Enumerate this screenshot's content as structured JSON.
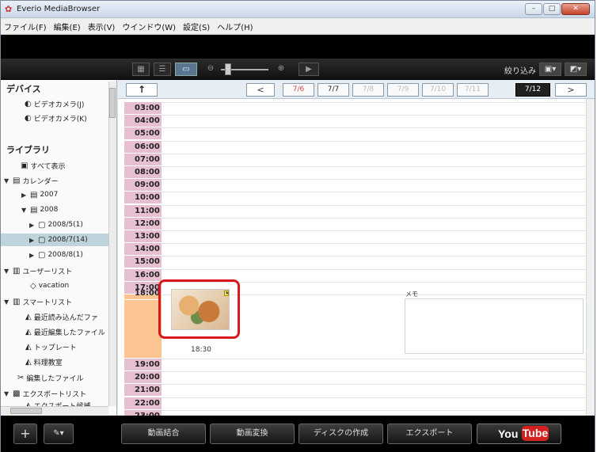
{
  "window": {
    "title": "Everio MediaBrowser",
    "controls": {
      "minimize": "–",
      "maximize": "□",
      "close": "✕"
    }
  },
  "menubar": {
    "items": [
      "ファイル(F)",
      "編集(E)",
      "表示(V)",
      "ウインドウ(W)",
      "設定(S)",
      "ヘルプ(H)"
    ]
  },
  "toolbar": {
    "filter_label": "絞り込み",
    "view_icons": [
      "grid-view-icon",
      "list-view-icon",
      "calendar-view-icon"
    ],
    "zoom_level": 0.15
  },
  "sidebar": {
    "devices_header": "デバイス",
    "devices": [
      "ビデオカメラ(J)",
      "ビデオカメラ(K)"
    ],
    "library_header": "ライブラリ",
    "library": [
      {
        "label": "すべて表示",
        "arrow": ""
      },
      {
        "label": "カレンダー",
        "arrow": "▼"
      },
      {
        "label": "2007",
        "arrow": "▶"
      },
      {
        "label": "2008",
        "arrow": "▼"
      },
      {
        "label": "2008/5(1)",
        "arrow": "▶"
      },
      {
        "label": "2008/7(14)",
        "arrow": "▶"
      },
      {
        "label": "2008/8(1)",
        "arrow": "▶"
      },
      {
        "label": "ユーザーリスト",
        "arrow": "▼"
      },
      {
        "label": "vacation",
        "arrow": ""
      },
      {
        "label": "スマートリスト",
        "arrow": "▼"
      },
      {
        "label": "最近読み込んだファ",
        "arrow": ""
      },
      {
        "label": "最近編集したファイル",
        "arrow": ""
      },
      {
        "label": "トップレート",
        "arrow": ""
      },
      {
        "label": "料理教室",
        "arrow": ""
      },
      {
        "label": "編集したファイル",
        "arrow": ""
      },
      {
        "label": "エクスポートリスト",
        "arrow": "▼"
      },
      {
        "label": "エクスポート候補",
        "arrow": ""
      }
    ],
    "selected_item": "2008/7(14)"
  },
  "navbar": {
    "up_label": "↑",
    "prev_label": "<",
    "next_label": ">",
    "dates": [
      "7/6",
      "7/7",
      "7/8",
      "7/9",
      "7/10",
      "7/11",
      "7/12"
    ],
    "current_date": "7/12"
  },
  "timeline": {
    "hours_top": [
      "03:00",
      "04:00",
      "05:00",
      "06:00",
      "07:00",
      "08:00",
      "09:00",
      "10:00",
      "11:00",
      "12:00",
      "13:00",
      "14:00",
      "15:00",
      "16:00",
      "17:00"
    ],
    "hour_expanded": "18:00",
    "hours_bottom": [
      "19:00",
      "20:00",
      "21:00",
      "22:00",
      "23:00"
    ],
    "thumbnail_time": "18:30",
    "memo_label": "メモ"
  },
  "bottombar": {
    "add_label": "+",
    "tools_label": "✎▾",
    "buttons": [
      "動画結合",
      "動画変換",
      "ディスクの作成",
      "エクスポート"
    ],
    "youtube_you": "You",
    "youtube_tube": "Tube"
  },
  "colors": {
    "hour_label_bg": "#e6c0d0",
    "expanded_hour_bg": "#fbc490",
    "highlight_frame": "#d8181c",
    "current_date_bg": "#202020",
    "weekend_date": "#d24848",
    "youtube_red": "#d42020"
  }
}
